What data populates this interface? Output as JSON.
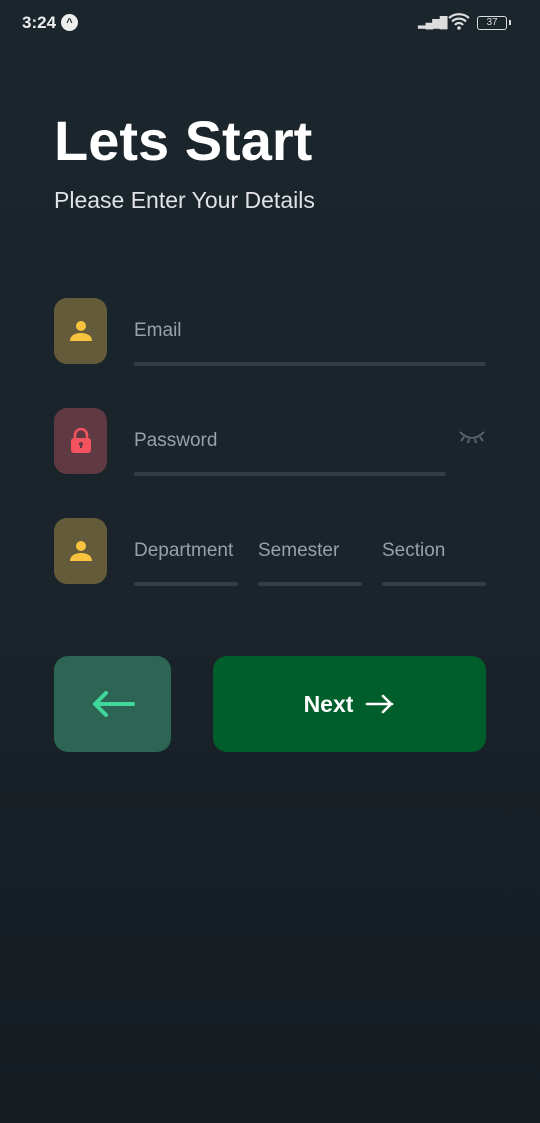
{
  "status_bar": {
    "time": "3:24",
    "app_badge": "^",
    "battery": "37"
  },
  "header": {
    "title": "Lets Start",
    "subtitle": "Please Enter Your Details"
  },
  "form": {
    "email": {
      "placeholder": "Email",
      "icon": "person-icon"
    },
    "password": {
      "placeholder": "Password",
      "icon": "lock-icon",
      "toggle_icon": "eye-closed-icon"
    },
    "details": {
      "icon": "person-icon",
      "department": "Department",
      "semester": "Semester",
      "section": "Section"
    }
  },
  "actions": {
    "back_icon": "arrow-left-icon",
    "next_label": "Next",
    "next_icon": "arrow-right-icon"
  },
  "colors": {
    "person_icon": "#f8c23e",
    "lock_icon": "#f2535f",
    "back_arrow": "#3fd79a",
    "next_button": "#005e2a",
    "back_button": "#2c6553"
  }
}
